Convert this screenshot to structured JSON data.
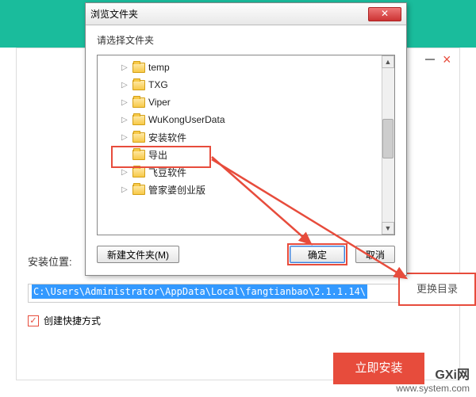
{
  "installer": {
    "location_label": "安装位置:",
    "path": "C:\\Users\\Administrator\\AppData\\Local\\fangtianbao\\2.1.1.14\\",
    "change_dir": "更换目录",
    "shortcut_label": "创建快捷方式",
    "install_now": "立即安装"
  },
  "dialog": {
    "title": "浏览文件夹",
    "instruction": "请选择文件夹",
    "folders": [
      "temp",
      "TXG",
      "Viper",
      "WuKongUserData",
      "安装软件",
      "导出",
      "飞豆软件",
      "管家婆创业版"
    ],
    "new_folder": "新建文件夹(M)",
    "ok": "确定",
    "cancel": "取消"
  },
  "watermark": {
    "line1": "GXi网",
    "line2": "www.system.com"
  }
}
